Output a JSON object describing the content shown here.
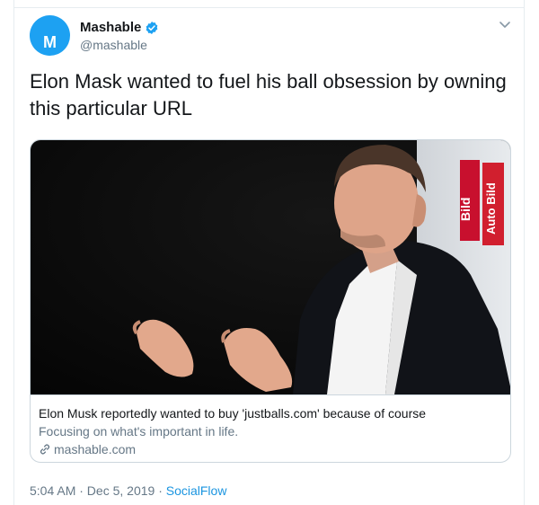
{
  "tweet": {
    "author_name": "Mashable",
    "author_handle": "@mashable",
    "avatar_letter": "M",
    "text": "Elon Mask wanted to fuel his ball obsession by owning this particular URL",
    "card": {
      "title": "Elon Musk reportedly wanted to buy 'justballs.com' because of course",
      "description": "Focusing on what's important in life.",
      "domain": "mashable.com",
      "backdrop_text_1": "Bild",
      "backdrop_text_2": "Auto Bild"
    },
    "timestamp": "5:04 AM · Dec 5, 2019 ·",
    "source": "SocialFlow"
  },
  "icons": {
    "verified": "verified-badge-icon",
    "menu": "chevron-down-icon",
    "link": "link-icon"
  },
  "colors": {
    "brand_blue": "#1da1f2",
    "link_blue": "#1b95e0",
    "secondary_text": "#657786",
    "border": "#ccd6dd"
  }
}
